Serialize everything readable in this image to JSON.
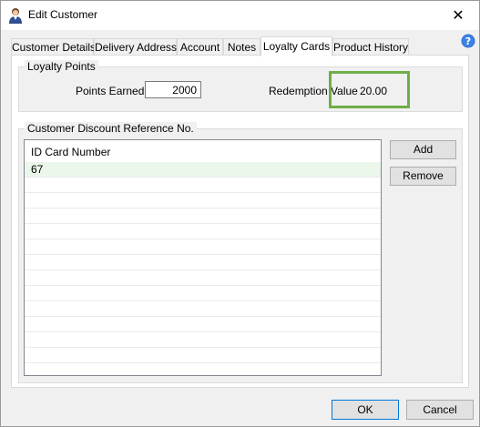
{
  "window": {
    "title": "Edit Customer",
    "close_glyph": "✕",
    "icon": "user-icon",
    "accent_color": "#0078d7"
  },
  "tabs": [
    {
      "label": "Customer Details",
      "active": false
    },
    {
      "label": "Delivery Address",
      "active": false
    },
    {
      "label": "Account",
      "active": false
    },
    {
      "label": "Notes",
      "active": false
    },
    {
      "label": "Loyalty Cards",
      "active": true
    },
    {
      "label": "Product History",
      "active": false
    }
  ],
  "loyalty_points": {
    "group_title": "Loyalty Points",
    "points_earned_label": "Points Earned",
    "points_earned_value": "2000",
    "redemption_value_label": "Redemption Value",
    "redemption_value": "20.00",
    "highlight_color": "#70ad47"
  },
  "discount_reference": {
    "group_title": "Customer Discount Reference No.",
    "column_header": "ID Card Number",
    "rows": [
      "67"
    ],
    "add_label": "Add",
    "remove_label": "Remove"
  },
  "footer": {
    "ok_label": "OK",
    "cancel_label": "Cancel"
  }
}
